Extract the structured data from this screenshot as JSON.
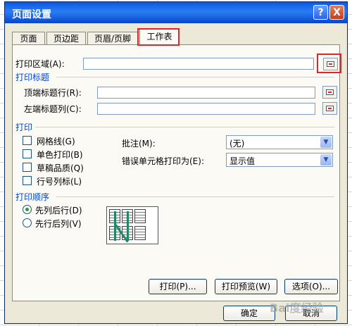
{
  "dialog": {
    "title": "页面设置"
  },
  "titlebar": {
    "help": "?",
    "close": "X"
  },
  "tabs": [
    "页面",
    "页边距",
    "页眉/页脚",
    "工作表"
  ],
  "print_area": {
    "label": "打印区域(A):",
    "value": ""
  },
  "print_titles": {
    "group": "打印标题",
    "top_rows_label": "顶端标题行(R):",
    "left_cols_label": "左端标题列(C):"
  },
  "print": {
    "group": "打印",
    "gridlines": "网格线(G)",
    "mono": "单色打印(B)",
    "draft": "草稿品质(Q)",
    "row_col_headers": "行号列标(L)",
    "comments_label": "批注(M):",
    "comments_value": "(无)",
    "errors_label": "错误单元格打印为(E):",
    "errors_value": "显示值"
  },
  "page_order": {
    "group": "打印顺序",
    "down_then_over": "先列后行(D)",
    "over_then_down": "先行后列(V)"
  },
  "buttons": {
    "print": "打印(P)...",
    "preview": "打印预览(W)",
    "options": "选项(O)...",
    "ok": "确定",
    "cancel": "取消"
  },
  "watermark": "Bai度经验"
}
